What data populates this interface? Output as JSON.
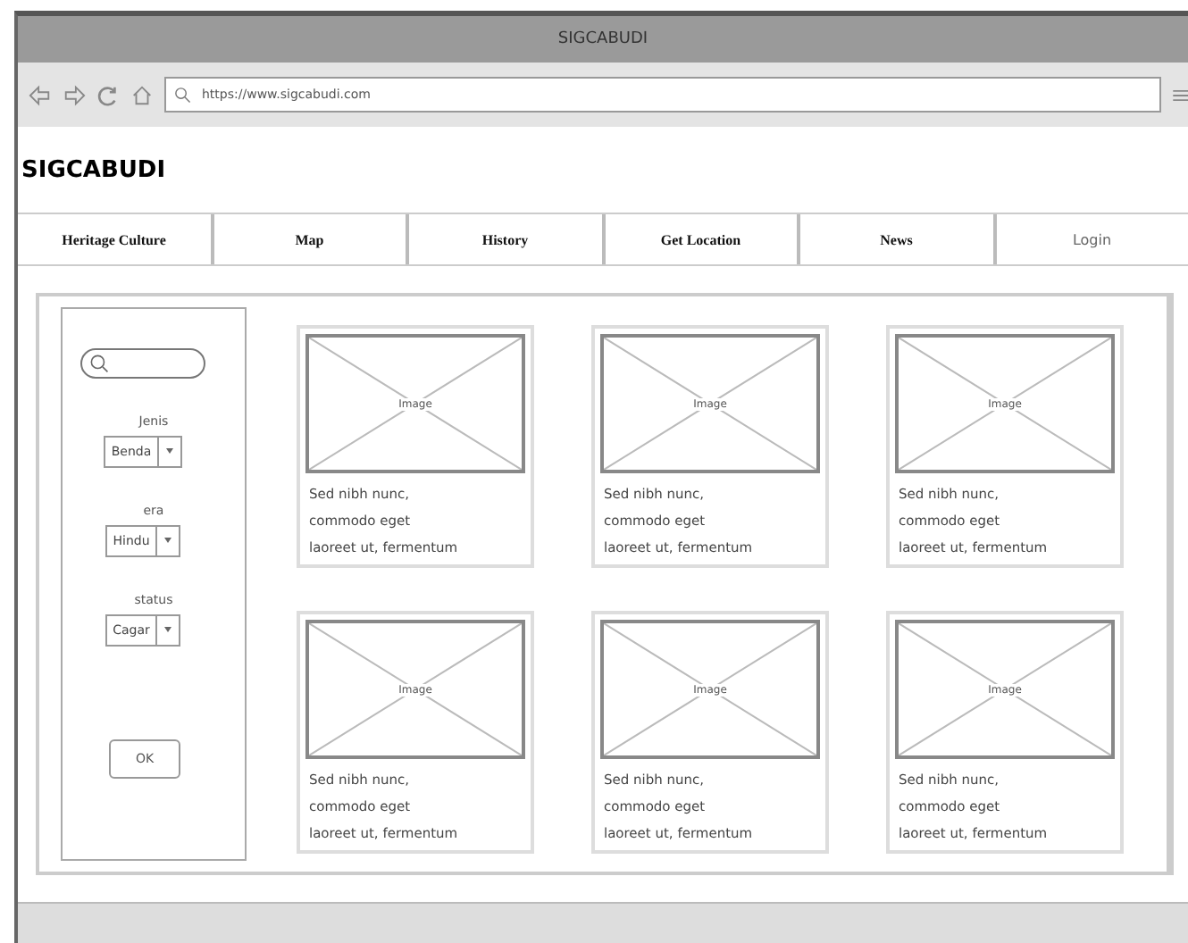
{
  "window": {
    "title": "SIGCABUDI"
  },
  "browser": {
    "url": "https://www.sigcabudi.com"
  },
  "site": {
    "title": "SIGCABUDI"
  },
  "nav": [
    {
      "label": "Heritage Culture",
      "kind": "serif"
    },
    {
      "label": "Map",
      "kind": "serif"
    },
    {
      "label": "History",
      "kind": "serif"
    },
    {
      "label": "Get Location",
      "kind": "serif"
    },
    {
      "label": "News",
      "kind": "serif"
    },
    {
      "label": "Login",
      "kind": "sans"
    }
  ],
  "filters": [
    {
      "label": "Jenis",
      "value": "Benda"
    },
    {
      "label": "era",
      "value": "Hindu"
    },
    {
      "label": "status",
      "value": "Cagar"
    }
  ],
  "ok_button": "OK",
  "cards": [
    {
      "image_label": "Image",
      "lines": [
        "Sed nibh nunc,",
        "commodo eget",
        "laoreet ut, fermentum"
      ]
    },
    {
      "image_label": "Image",
      "lines": [
        "Sed nibh nunc,",
        "commodo eget",
        "laoreet ut, fermentum"
      ]
    },
    {
      "image_label": "Image",
      "lines": [
        "Sed nibh nunc,",
        "commodo eget",
        "laoreet ut, fermentum"
      ]
    },
    {
      "image_label": "Image",
      "lines": [
        "Sed nibh nunc,",
        "commodo eget",
        "laoreet ut, fermentum"
      ]
    },
    {
      "image_label": "Image",
      "lines": [
        "Sed nibh nunc,",
        "commodo eget",
        "laoreet ut, fermentum"
      ]
    },
    {
      "image_label": "Image",
      "lines": [
        "Sed nibh nunc,",
        "commodo eget",
        "laoreet ut, fermentum"
      ]
    }
  ]
}
